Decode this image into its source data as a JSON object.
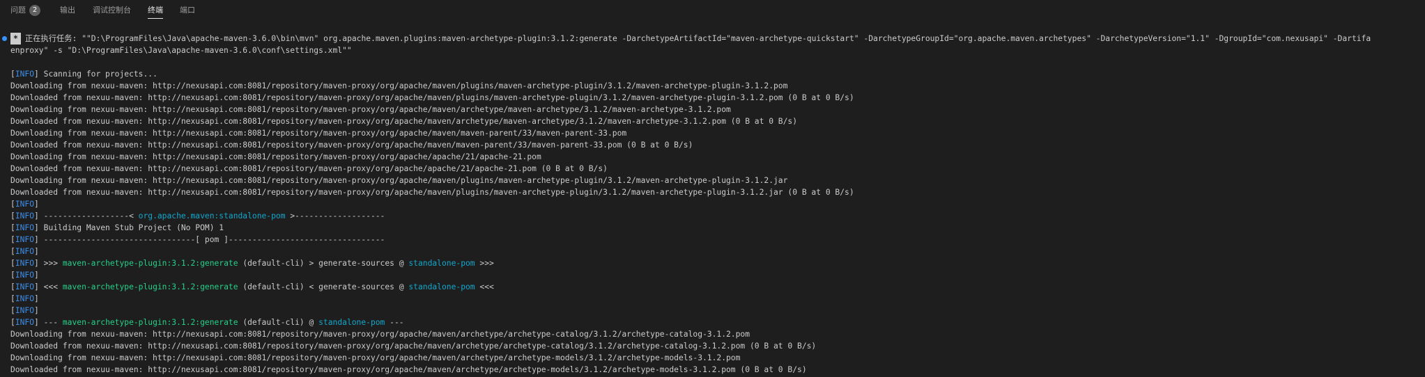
{
  "tabs": [
    {
      "label": "问题",
      "badge": "2",
      "active": false
    },
    {
      "label": "输出",
      "active": false
    },
    {
      "label": "调试控制台",
      "active": false
    },
    {
      "label": "终端",
      "active": true
    },
    {
      "label": "端口",
      "active": false
    }
  ],
  "task": {
    "marker": "*",
    "line1": "正在执行任务: \"\"D:\\ProgramFiles\\Java\\apache-maven-3.6.0\\bin\\mvn\" org.apache.maven.plugins:maven-archetype-plugin:3.1.2:generate -DarchetypeArtifactId=\"maven-archetype-quickstart\" -DarchetypeGroupId=\"org.apache.maven.archetypes\" -DarchetypeVersion=\"1.1\" -DgroupId=\"com.nexusapi\" -Dartifa",
    "line2": "enproxy\" -s \"D:\\ProgramFiles\\Java\\apache-maven-3.6.0\\conf\\settings.xml\"\""
  },
  "info_tag": "INFO",
  "log": {
    "scanning": " Scanning for projects...",
    "dl1": "Downloading from nexuu-maven: http://nexusapi.com:8081/repository/maven-proxy/org/apache/maven/plugins/maven-archetype-plugin/3.1.2/maven-archetype-plugin-3.1.2.pom",
    "dd1": "Downloaded from nexuu-maven: http://nexusapi.com:8081/repository/maven-proxy/org/apache/maven/plugins/maven-archetype-plugin/3.1.2/maven-archetype-plugin-3.1.2.pom (0 B at 0 B/s)",
    "dl2": "Downloading from nexuu-maven: http://nexusapi.com:8081/repository/maven-proxy/org/apache/maven/archetype/maven-archetype/3.1.2/maven-archetype-3.1.2.pom",
    "dd2": "Downloaded from nexuu-maven: http://nexusapi.com:8081/repository/maven-proxy/org/apache/maven/archetype/maven-archetype/3.1.2/maven-archetype-3.1.2.pom (0 B at 0 B/s)",
    "dl3": "Downloading from nexuu-maven: http://nexusapi.com:8081/repository/maven-proxy/org/apache/maven/maven-parent/33/maven-parent-33.pom",
    "dd3": "Downloaded from nexuu-maven: http://nexusapi.com:8081/repository/maven-proxy/org/apache/maven/maven-parent/33/maven-parent-33.pom (0 B at 0 B/s)",
    "dl4": "Downloading from nexuu-maven: http://nexusapi.com:8081/repository/maven-proxy/org/apache/apache/21/apache-21.pom",
    "dd4": "Downloaded from nexuu-maven: http://nexusapi.com:8081/repository/maven-proxy/org/apache/apache/21/apache-21.pom (0 B at 0 B/s)",
    "dl5": "Downloading from nexuu-maven: http://nexusapi.com:8081/repository/maven-proxy/org/apache/maven/plugins/maven-archetype-plugin/3.1.2/maven-archetype-plugin-3.1.2.jar",
    "dd5": "Downloaded from nexuu-maven: http://nexusapi.com:8081/repository/maven-proxy/org/apache/maven/plugins/maven-archetype-plugin/3.1.2/maven-archetype-plugin-3.1.2.jar (0 B at 0 B/s)",
    "sep1_left": " ------------------< ",
    "sep1_id": "org.apache.maven:standalone-pom",
    "sep1_right": " >-------------------",
    "building": " Building Maven Stub Project (No POM) 1",
    "sep2": " --------------------------------[ pom ]---------------------------------",
    "fwd_prefix": " >>> ",
    "goal": "maven-archetype-plugin:3.1.2:generate",
    "fwd_mid": " (default-cli) > generate-sources @ ",
    "pom_id": "standalone-pom",
    "fwd_suffix": " >>>",
    "back_prefix": " <<< ",
    "back_mid": " (default-cli) < generate-sources @ ",
    "back_suffix": " <<<",
    "exec_prefix": " --- ",
    "exec_mid": " (default-cli) @ ",
    "exec_suffix": " ---",
    "dl6": "Downloading from nexuu-maven: http://nexusapi.com:8081/repository/maven-proxy/org/apache/maven/archetype/archetype-catalog/3.1.2/archetype-catalog-3.1.2.pom",
    "dd6": "Downloaded from nexuu-maven: http://nexusapi.com:8081/repository/maven-proxy/org/apache/maven/archetype/archetype-catalog/3.1.2/archetype-catalog-3.1.2.pom (0 B at 0 B/s)",
    "dl7": "Downloading from nexuu-maven: http://nexusapi.com:8081/repository/maven-proxy/org/apache/maven/archetype/archetype-models/3.1.2/archetype-models-3.1.2.pom",
    "dd7": "Downloaded from nexuu-maven: http://nexusapi.com:8081/repository/maven-proxy/org/apache/maven/archetype/archetype-models/3.1.2/archetype-models-3.1.2.pom (0 B at 0 B/s)"
  }
}
